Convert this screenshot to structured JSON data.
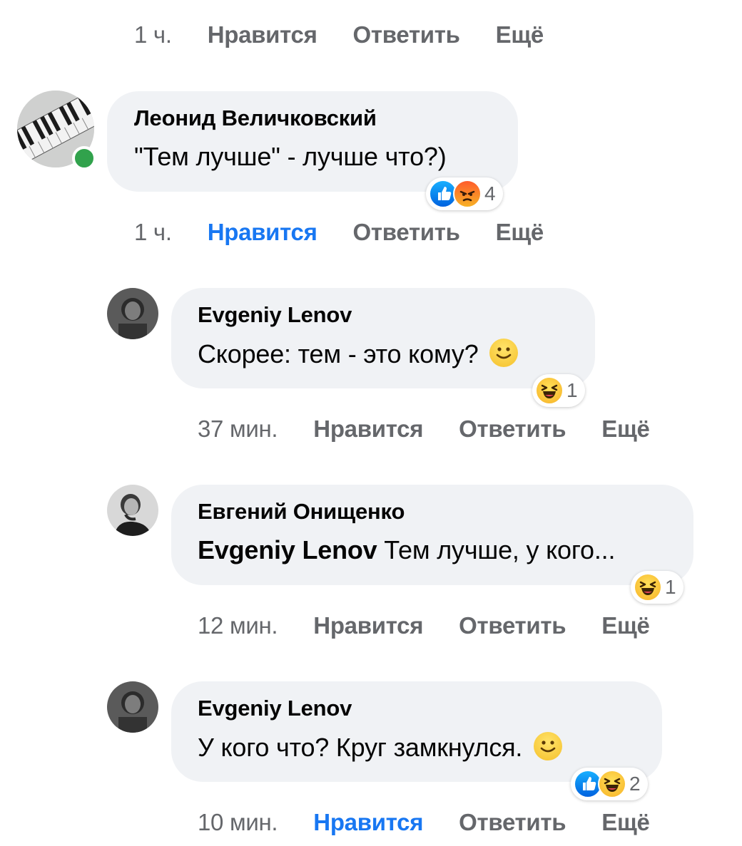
{
  "top_actions": {
    "time": "1 ч.",
    "like": "Нравится",
    "reply": "Ответить",
    "more": "Ещё"
  },
  "comments": [
    {
      "author": "Леонид Величковский",
      "text": "\"Тем лучше\" - лучше что?)",
      "reaction_icons": [
        "like-icon",
        "angry-icon"
      ],
      "reaction_count": "4",
      "time": "1 ч.",
      "like": "Нравится",
      "reply": "Ответить",
      "more": "Ещё",
      "liked": true,
      "online": true
    },
    {
      "author": "Evgeniy Lenov",
      "text": "Скорее: тем - это кому?",
      "trailing_emoji": "slightly-smiling-face-emoji",
      "reaction_icons": [
        "haha-icon"
      ],
      "reaction_count": "1",
      "time": "37 мин.",
      "like": "Нравится",
      "reply": "Ответить",
      "more": "Ещё",
      "liked": false
    },
    {
      "author": "Евгений Онищенко",
      "mention": "Evgeniy Lenov",
      "text": " Тем лучше, у кого...",
      "reaction_icons": [
        "haha-icon"
      ],
      "reaction_count": "1",
      "time": "12 мин.",
      "like": "Нравится",
      "reply": "Ответить",
      "more": "Ещё",
      "liked": false
    },
    {
      "author": "Evgeniy Lenov",
      "text": "У кого что? Круг замкнулся.",
      "trailing_emoji": "slightly-smiling-face-emoji",
      "reaction_icons": [
        "like-icon",
        "haha-icon"
      ],
      "reaction_count": "2",
      "time": "10 мин.",
      "like": "Нравится",
      "reply": "Ответить",
      "more": "Ещё",
      "liked": true
    }
  ],
  "colors": {
    "bubble": "#f0f2f5",
    "secondary_text": "#65676b",
    "active_like": "#1877f2",
    "online": "#31a24c"
  }
}
